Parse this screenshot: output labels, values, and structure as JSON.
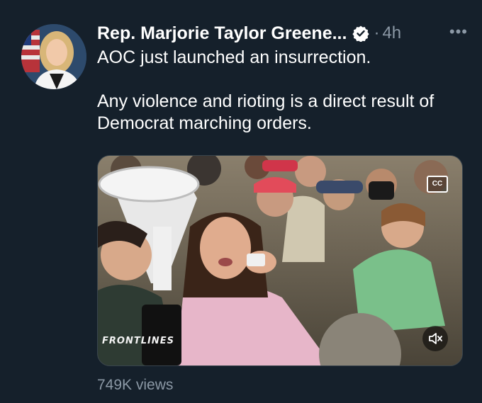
{
  "tweet": {
    "author_name": "Rep. Marjorie Taylor Greene...",
    "separator": "·",
    "timestamp": "4h",
    "more_label": "•••",
    "text_line_1": "AOC just launched an insurrection.",
    "text_line_2": "Any violence and rioting is a direct result of Democrat marching orders.",
    "views": "749K views"
  },
  "media": {
    "captions_label": "CC",
    "watermark": "FRONTLINES"
  },
  "icons": {
    "verified": "verified-badge-icon",
    "more": "more-options-icon",
    "captions": "closed-captions-icon",
    "mute": "mute-speaker-icon"
  },
  "colors": {
    "background": "#15202b",
    "primary_text": "#ffffff",
    "secondary_text": "#8b98a5",
    "verified": "#ffffff"
  }
}
